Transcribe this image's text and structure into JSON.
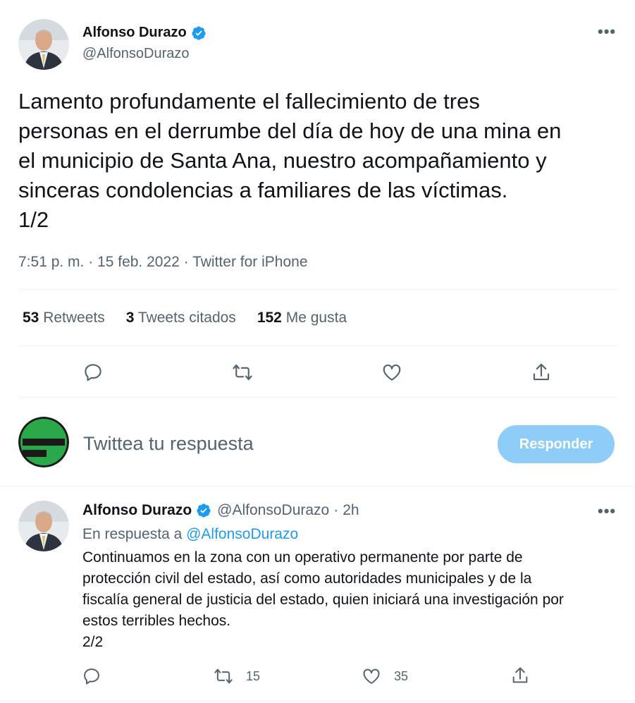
{
  "main_tweet": {
    "author_name": "Alfonso Durazo",
    "author_handle": "@AlfonsoDurazo",
    "text_lines": [
      "Lamento profundamente el fallecimiento de tres",
      "personas en el derrumbe del día de hoy de una mina en",
      "el municipio de Santa Ana, nuestro acompañamiento y",
      "sinceras condolencias a familiares de las víctimas.",
      "1/2"
    ],
    "meta": "7:51 p. m. · 15 feb. 2022 · Twitter for iPhone",
    "stats": {
      "retweets_count": "53",
      "retweets_label": "Retweets",
      "quotes_count": "3",
      "quotes_label": "Tweets citados",
      "likes_count": "152",
      "likes_label": "Me gusta"
    }
  },
  "composer": {
    "placeholder": "Twittea tu respuesta",
    "button_label": "Responder"
  },
  "reply_tweet": {
    "author_name": "Alfonso Durazo",
    "author_handle": "@AlfonsoDurazo",
    "separator": "·",
    "time": "2h",
    "reply_to_label": "En respuesta a",
    "reply_to_handle": "@AlfonsoDurazo",
    "text_lines": [
      "Continuamos en la zona con un operativo permanente por parte de",
      "protección civil del estado, así como autoridades municipales y de la",
      "fiscalía general de justicia del estado, quien iniciará una investigación por",
      "estos terribles hechos.",
      "2/2"
    ],
    "retweet_count": "15",
    "like_count": "35"
  },
  "colors": {
    "verified": "#1d9bf0",
    "accent": "#1d9bf0",
    "button_disabled": "#8ecdf8",
    "secondary_text": "#536471",
    "logo_green": "#2aa84a"
  },
  "icons": [
    "verified-badge-icon",
    "more-icon",
    "reply-icon",
    "retweet-icon",
    "like-icon",
    "share-icon"
  ]
}
